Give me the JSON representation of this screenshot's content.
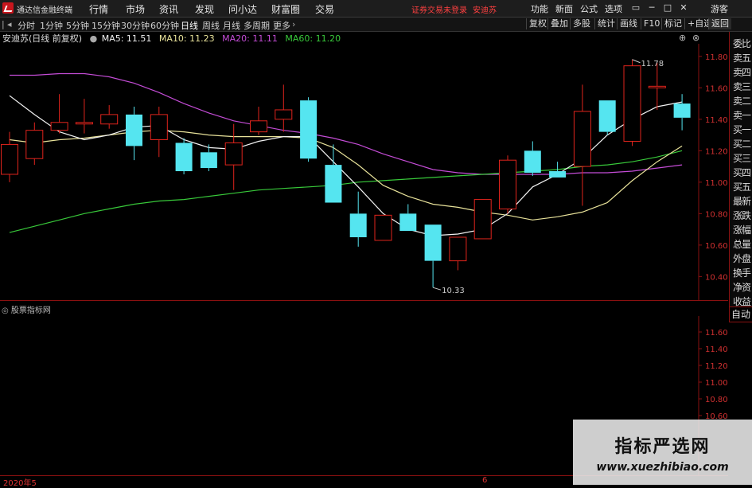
{
  "titlebar": {
    "app_title": "通达信金融终端",
    "menus": [
      "行情",
      "市场",
      "资讯",
      "发现",
      "问小达",
      "财富圈",
      "交易"
    ],
    "warning": "证券交易未登录",
    "stock_name": "安迪苏",
    "right_menus": [
      "功能",
      "新面",
      "公式",
      "选项"
    ],
    "guest": "游客"
  },
  "toolbar": {
    "timeframes": [
      "分时",
      "1分钟",
      "5分钟",
      "15分钟",
      "30分钟",
      "60分钟",
      "日线",
      "周线",
      "月线",
      "多周期",
      "更多"
    ],
    "active": "日线",
    "right_tools": [
      "复权",
      "叠加",
      "多股",
      "统计",
      "画线",
      "F10",
      "标记",
      "+自选",
      "返回"
    ]
  },
  "legend": {
    "title": "安迪苏(日线 前复权)",
    "ma5": "MA5: 11.51",
    "ma10": "MA10: 11.23",
    "ma20": "MA20: 11.11",
    "ma60": "MA60: 11.20"
  },
  "colors": {
    "up": "#e0241c",
    "down": "#55e5f0",
    "ma5": "#f2f2f2",
    "ma10": "#e8e29a",
    "ma20": "#c44cd6",
    "ma60": "#38c93a"
  },
  "chart_data": {
    "type": "candlestick",
    "price_axis": [
      "11.80",
      "11.60",
      "11.40",
      "11.20",
      "11.00",
      "10.80",
      "10.60",
      "10.40"
    ],
    "ylim": [
      10.25,
      11.88
    ],
    "high_label": "11.78",
    "low_label": "10.33",
    "candles": [
      {
        "o": 11.05,
        "c": 11.24,
        "h": 11.32,
        "l": 11.0
      },
      {
        "o": 11.15,
        "c": 11.33,
        "h": 11.38,
        "l": 11.11
      },
      {
        "o": 11.33,
        "c": 11.38,
        "h": 11.56,
        "l": 11.31
      },
      {
        "o": 11.37,
        "c": 11.38,
        "h": 11.53,
        "l": 11.31
      },
      {
        "o": 11.37,
        "c": 11.43,
        "h": 11.49,
        "l": 11.34
      },
      {
        "o": 11.43,
        "c": 11.23,
        "h": 11.48,
        "l": 11.14
      },
      {
        "o": 11.27,
        "c": 11.43,
        "h": 11.48,
        "l": 11.16
      },
      {
        "o": 11.25,
        "c": 11.07,
        "h": 11.28,
        "l": 11.05
      },
      {
        "o": 11.19,
        "c": 11.09,
        "h": 11.24,
        "l": 11.07
      },
      {
        "o": 11.11,
        "c": 11.25,
        "h": 11.37,
        "l": 10.95
      },
      {
        "o": 11.32,
        "c": 11.39,
        "h": 11.48,
        "l": 11.3
      },
      {
        "o": 11.4,
        "c": 11.46,
        "h": 11.62,
        "l": 11.32
      },
      {
        "o": 11.52,
        "c": 11.15,
        "h": 11.54,
        "l": 11.13
      },
      {
        "o": 11.11,
        "c": 10.87,
        "h": 11.24,
        "l": 10.87
      },
      {
        "o": 10.8,
        "c": 10.65,
        "h": 10.94,
        "l": 10.59
      },
      {
        "o": 10.63,
        "c": 10.79,
        "h": 10.79,
        "l": 10.63
      },
      {
        "o": 10.8,
        "c": 10.69,
        "h": 10.86,
        "l": 10.69
      },
      {
        "o": 10.73,
        "c": 10.5,
        "h": 10.73,
        "l": 10.33
      },
      {
        "o": 10.5,
        "c": 10.65,
        "h": 10.65,
        "l": 10.44
      },
      {
        "o": 10.64,
        "c": 10.89,
        "h": 10.89,
        "l": 10.64
      },
      {
        "o": 10.83,
        "c": 11.14,
        "h": 11.17,
        "l": 10.8
      },
      {
        "o": 11.2,
        "c": 11.06,
        "h": 11.26,
        "l": 11.04
      },
      {
        "o": 11.07,
        "c": 11.03,
        "h": 11.13,
        "l": 11.03
      },
      {
        "o": 11.1,
        "c": 11.45,
        "h": 11.62,
        "l": 10.85
      },
      {
        "o": 11.52,
        "c": 11.32,
        "h": 11.52,
        "l": 11.3
      },
      {
        "o": 11.26,
        "c": 11.74,
        "h": 11.78,
        "l": 11.23
      },
      {
        "o": 11.6,
        "c": 11.61,
        "h": 11.76,
        "l": 11.46
      },
      {
        "o": 11.5,
        "c": 11.41,
        "h": 11.56,
        "l": 11.33
      }
    ],
    "ma5": [
      11.55,
      11.43,
      11.32,
      11.27,
      11.3,
      11.35,
      11.36,
      11.27,
      11.22,
      11.21,
      11.26,
      11.29,
      11.29,
      11.13,
      10.97,
      10.8,
      10.7,
      10.66,
      10.67,
      10.7,
      10.8,
      10.97,
      11.05,
      11.15,
      11.3,
      11.4,
      11.48,
      11.51
    ],
    "ma10": [
      11.27,
      11.25,
      11.27,
      11.28,
      11.3,
      11.32,
      11.33,
      11.32,
      11.3,
      11.29,
      11.29,
      11.29,
      11.28,
      11.22,
      11.11,
      10.98,
      10.91,
      10.86,
      10.84,
      10.81,
      10.79,
      10.76,
      10.78,
      10.81,
      10.87,
      11.01,
      11.13,
      11.23
    ],
    "ma20": [
      11.68,
      11.68,
      11.69,
      11.69,
      11.67,
      11.63,
      11.57,
      11.5,
      11.44,
      11.39,
      11.36,
      11.33,
      11.31,
      11.28,
      11.24,
      11.18,
      11.13,
      11.08,
      11.06,
      11.05,
      11.05,
      11.05,
      11.05,
      11.06,
      11.06,
      11.07,
      11.09,
      11.11
    ],
    "ma60": [
      10.68,
      10.72,
      10.76,
      10.8,
      10.83,
      10.86,
      10.88,
      10.89,
      10.91,
      10.93,
      10.95,
      10.96,
      10.97,
      10.98,
      11.0,
      11.01,
      11.02,
      11.03,
      11.04,
      11.05,
      11.06,
      11.07,
      11.08,
      11.1,
      11.11,
      11.13,
      11.16,
      11.2
    ]
  },
  "sub_panel": {
    "title": "股票指标网",
    "axis": [
      "11.60",
      "11.40",
      "11.20",
      "11.00",
      "10.80",
      "10.60"
    ]
  },
  "right_panel": {
    "items": [
      "委比",
      "卖五",
      "卖四",
      "卖三",
      "卖二",
      "卖一",
      "买一",
      "买二",
      "买三",
      "买四",
      "买五",
      "最新",
      "涨跌",
      "涨幅",
      "总量",
      "外盘",
      "换手",
      "净资",
      "收益"
    ],
    "auto": "自动"
  },
  "bottom": {
    "date_label": "2020年5",
    "month_mark": "6"
  },
  "watermark": {
    "line1": "指标严选网",
    "line2": "www.xuezhibiao.com"
  }
}
